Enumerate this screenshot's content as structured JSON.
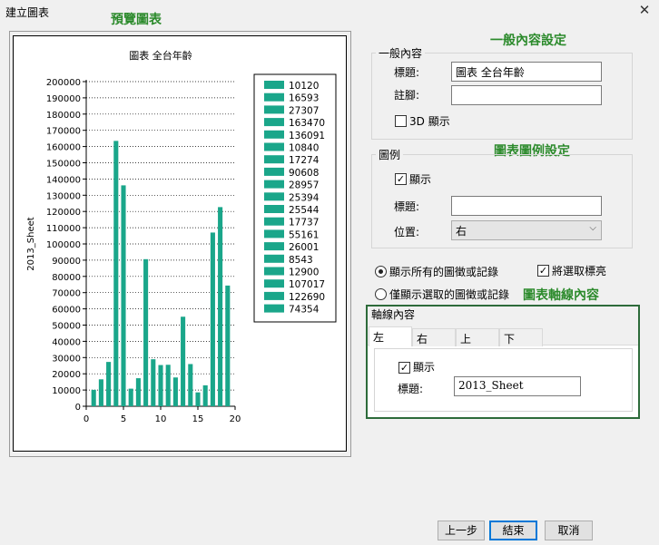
{
  "window": {
    "title": "建立圖表",
    "close": "✕"
  },
  "annotations": {
    "preview": "預覽圖表",
    "general": "一般內容設定",
    "legend": "圖表圖例設定",
    "axis": "圖表軸線內容"
  },
  "chart_data": {
    "type": "bar",
    "title": "圖表 全台年齡",
    "ylabel": "2013_Sheet",
    "xlabel": "",
    "x": [
      1,
      2,
      3,
      4,
      5,
      6,
      7,
      8,
      9,
      10,
      11,
      12,
      13,
      14,
      15,
      16,
      17,
      18,
      19
    ],
    "values": [
      10120,
      16593,
      27307,
      163470,
      136091,
      10840,
      17274,
      90608,
      28957,
      25394,
      25544,
      17737,
      55161,
      26001,
      8543,
      12900,
      107017,
      122690,
      74354
    ],
    "xlim": [
      0,
      20
    ],
    "ylim": [
      0,
      200000
    ],
    "xticks": [
      0,
      5,
      10,
      15,
      20
    ],
    "yticks": [
      0,
      10000,
      20000,
      30000,
      40000,
      50000,
      60000,
      70000,
      80000,
      90000,
      100000,
      110000,
      120000,
      130000,
      140000,
      150000,
      160000,
      170000,
      180000,
      190000,
      200000
    ],
    "color": "#1aa68a",
    "grid": true,
    "legend_position": "right",
    "legend_entries": [
      "10120",
      "16593",
      "27307",
      "163470",
      "136091",
      "10840",
      "17274",
      "90608",
      "28957",
      "25394",
      "25544",
      "17737",
      "55161",
      "26001",
      "8543",
      "12900",
      "107017",
      "122690",
      "74354"
    ]
  },
  "general": {
    "group_label": "一般內容",
    "title_label": "標題:",
    "title_value": "圖表 全台年齡",
    "footnote_label": "註腳:",
    "footnote_value": "",
    "threed_label": "3D 顯示",
    "threed_checked": false
  },
  "legend": {
    "group_label": "圖例",
    "show_label": "顯示",
    "show_checked": true,
    "title_label": "標題:",
    "title_value": "",
    "position_label": "位置:",
    "position_value": "右"
  },
  "records": {
    "all_label": "顯示所有的圖徵或記錄",
    "selected_label": "僅顯示選取的圖徵或記錄",
    "highlight_label": "將選取標亮",
    "highlight_checked": true,
    "selected_option": "all"
  },
  "axis": {
    "group_label": "軸線內容",
    "tabs": [
      "左",
      "右",
      "上",
      "下"
    ],
    "active_tab": "左",
    "show_label": "顯示",
    "show_checked": true,
    "title_label": "標題:",
    "title_value": "2013_Sheet"
  },
  "footer": {
    "back": "上一步",
    "finish": "結束",
    "cancel": "取消"
  }
}
